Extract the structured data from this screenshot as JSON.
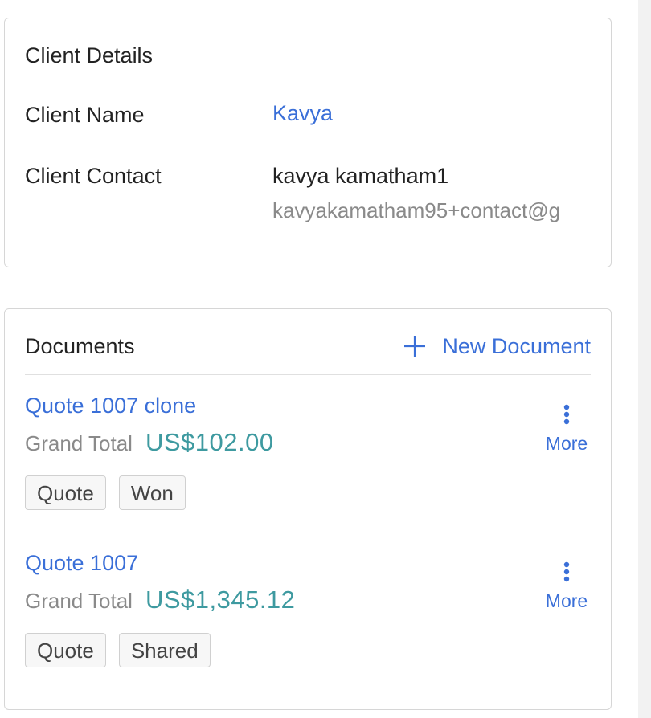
{
  "client": {
    "title": "Client Details",
    "name_label": "Client Name",
    "name_value": "Kavya",
    "contact_label": "Client Contact",
    "contact_name": "kavya kamatham1",
    "contact_email": "kavyakamatham95+contact@g"
  },
  "documents": {
    "title": "Documents",
    "new_label": "New Document",
    "items": [
      {
        "title": "Quote 1007 clone",
        "total_label": "Grand Total",
        "total_value": "US$102.00",
        "tags": [
          "Quote",
          "Won"
        ],
        "more_label": "More"
      },
      {
        "title": "Quote 1007",
        "total_label": "Grand Total",
        "total_value": "US$1,345.12",
        "tags": [
          "Quote",
          "Shared"
        ],
        "more_label": "More"
      }
    ]
  },
  "icons": {
    "plus": "plus-icon",
    "more": "vertical-dots-icon"
  },
  "colors": {
    "link": "#3a6fd8",
    "amount": "#3e9aa0",
    "muted": "#8a8a8a"
  }
}
